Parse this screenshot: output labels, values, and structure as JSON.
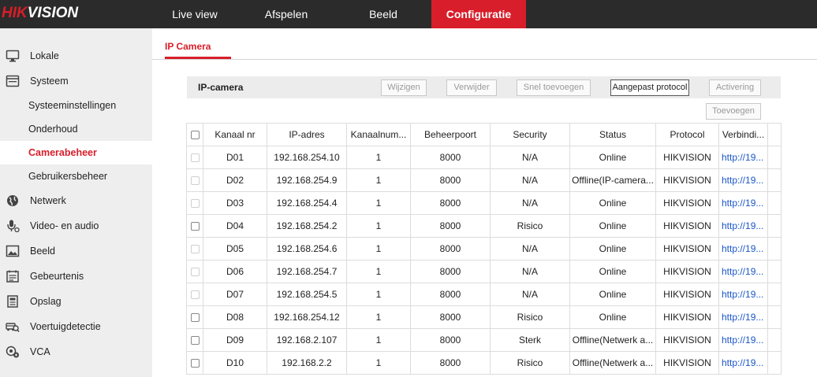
{
  "brand": {
    "hik": "HIK",
    "vision": "VISION"
  },
  "nav": [
    {
      "label": "Live view"
    },
    {
      "label": "Afspelen"
    },
    {
      "label": "Beeld"
    },
    {
      "label": "Configuratie"
    }
  ],
  "sidebar": {
    "items": [
      {
        "label": "Lokale",
        "icon": "monitor-icon"
      },
      {
        "label": "Systeem",
        "icon": "system-icon"
      },
      {
        "label": "Systeeminstellingen"
      },
      {
        "label": "Onderhoud"
      },
      {
        "label": "Camerabeheer"
      },
      {
        "label": "Gebruikersbeheer"
      },
      {
        "label": "Netwerk",
        "icon": "globe-icon"
      },
      {
        "label": "Video- en audio",
        "icon": "microphone-icon"
      },
      {
        "label": "Beeld",
        "icon": "image-icon"
      },
      {
        "label": "Gebeurtenis",
        "icon": "calendar-icon"
      },
      {
        "label": "Opslag",
        "icon": "storage-icon"
      },
      {
        "label": "Voertuigdetectie",
        "icon": "vehicle-search-icon"
      },
      {
        "label": "VCA",
        "icon": "vca-icon"
      }
    ]
  },
  "tab": {
    "label": "IP Camera"
  },
  "toolbar": {
    "title": "IP-camera",
    "buttons": [
      "Wijzigen",
      "Verwijder",
      "Snel toevoegen",
      "Aangepast protocol",
      "Activering",
      "Toevoegen"
    ]
  },
  "table": {
    "headers": [
      "Kanaal nr",
      "IP-adres",
      "Kanaalnum...",
      "Beheerpoort",
      "Security",
      "Status",
      "Protocol",
      "Verbindi..."
    ],
    "rows": [
      [
        "D01",
        "192.168.254.10",
        "1",
        "8000",
        "N/A",
        "Online",
        "HIKVISION",
        "http://19..."
      ],
      [
        "D02",
        "192.168.254.9",
        "1",
        "8000",
        "N/A",
        "Offline(IP-camera...",
        "HIKVISION",
        "http://19..."
      ],
      [
        "D03",
        "192.168.254.4",
        "1",
        "8000",
        "N/A",
        "Online",
        "HIKVISION",
        "http://19..."
      ],
      [
        "D04",
        "192.168.254.2",
        "1",
        "8000",
        "Risico",
        "Online",
        "HIKVISION",
        "http://19..."
      ],
      [
        "D05",
        "192.168.254.6",
        "1",
        "8000",
        "N/A",
        "Online",
        "HIKVISION",
        "http://19..."
      ],
      [
        "D06",
        "192.168.254.7",
        "1",
        "8000",
        "N/A",
        "Online",
        "HIKVISION",
        "http://19..."
      ],
      [
        "D07",
        "192.168.254.5",
        "1",
        "8000",
        "N/A",
        "Online",
        "HIKVISION",
        "http://19..."
      ],
      [
        "D08",
        "192.168.254.12",
        "1",
        "8000",
        "Risico",
        "Online",
        "HIKVISION",
        "http://19..."
      ],
      [
        "D09",
        "192.168.2.107",
        "1",
        "8000",
        "Sterk",
        "Offline(Netwerk a...",
        "HIKVISION",
        "http://19..."
      ],
      [
        "D10",
        "192.168.2.2",
        "1",
        "8000",
        "Risico",
        "Offline(Netwerk a...",
        "HIKVISION",
        "http://19..."
      ]
    ],
    "checkbox_dimmed": [
      true,
      true,
      true,
      false,
      true,
      true,
      true,
      false,
      false,
      false
    ]
  },
  "colors": {
    "accent": "#d81e2a",
    "topbar": "#2b2b2b",
    "link": "#1a56c8",
    "sidebar": "#eeeeee"
  }
}
